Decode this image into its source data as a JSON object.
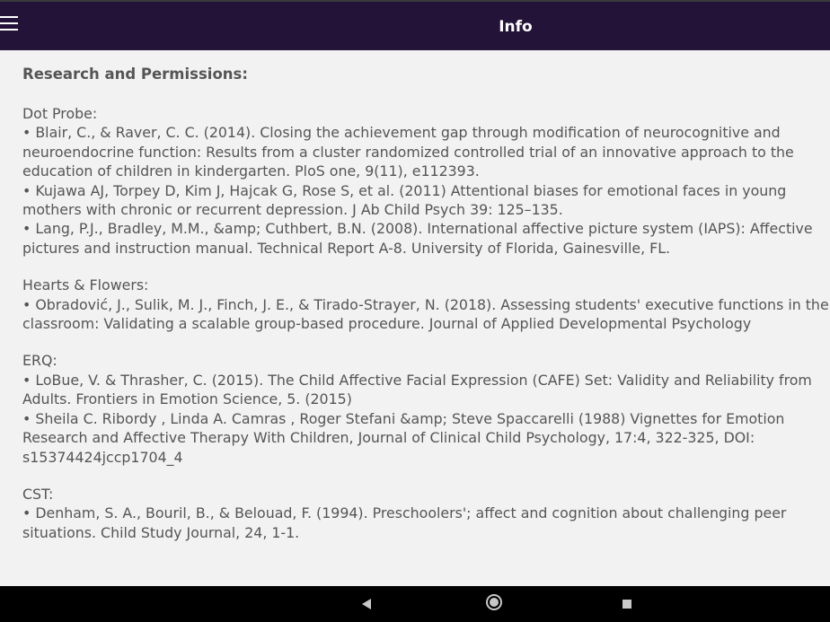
{
  "appbar": {
    "title": "Info",
    "menu_icon": "hamburger-menu-icon"
  },
  "content": {
    "heading": "Research and Permissions:",
    "sections": [
      {
        "title": "Dot Probe:",
        "refs": [
          [
            "• Blair, C., & Raver, C. C. (2014). Closing the achievement gap through modification of neurocognitive and",
            "neuroendocrine function: Results from a cluster randomized controlled trial of an innovative approach to the",
            "education of children in kindergarten. PloS one, 9(11), e112393."
          ],
          [
            "• Kujawa AJ, Torpey D, Kim J, Hajcak G, Rose S, et al. (2011) Attentional biases for emotional faces in young",
            "mothers with chronic or recurrent depression. J Ab Child Psych 39: 125–135."
          ],
          [
            "• Lang, P.J., Bradley, M.M., &amp; Cuthbert, B.N. (2008). International affective picture system (IAPS): Affective",
            "pictures and instruction manual. Technical Report A-8. University of Florida, Gainesville, FL."
          ]
        ]
      },
      {
        "title": "Hearts & Flowers:",
        "refs": [
          [
            "• Obradović, J., Sulik, M. J., Finch, J. E., & Tirado-Strayer, N. (2018). Assessing students' executive functions in the",
            "classroom: Validating a scalable group-based procedure. Journal of Applied Developmental Psychology"
          ]
        ]
      },
      {
        "title": "ERQ:",
        "refs": [
          [
            "• LoBue, V. & Thrasher, C. (2015). The Child Affective Facial Expression (CAFE) Set: Validity and Reliability from",
            "Adults. Frontiers in Emotion Science, 5. (2015)"
          ],
          [
            "• Sheila C. Ribordy , Linda A. Camras , Roger Stefani &amp; Steve Spaccarelli (1988) Vignettes for Emotion",
            "Research and Affective Therapy With Children, Journal of Clinical Child Psychology, 17:4, 322-325, DOI:",
            "s15374424jccp1704_4"
          ]
        ]
      },
      {
        "title": "CST:",
        "refs": [
          [
            "• Denham, S. A., Bouril, B., & Belouad, F. (1994). Preschoolers'; affect and cognition about challenging peer",
            "situations. Child Study Journal, 24, 1-1."
          ]
        ]
      }
    ]
  },
  "navbar": {
    "back_icon": "back-triangle-icon",
    "home_icon": "home-circle-icon",
    "recent_icon": "recent-apps-square-icon"
  },
  "colors": {
    "appbar": "#241338",
    "background": "#f2f2f2",
    "text": "#555555",
    "navbar": "#000000"
  }
}
